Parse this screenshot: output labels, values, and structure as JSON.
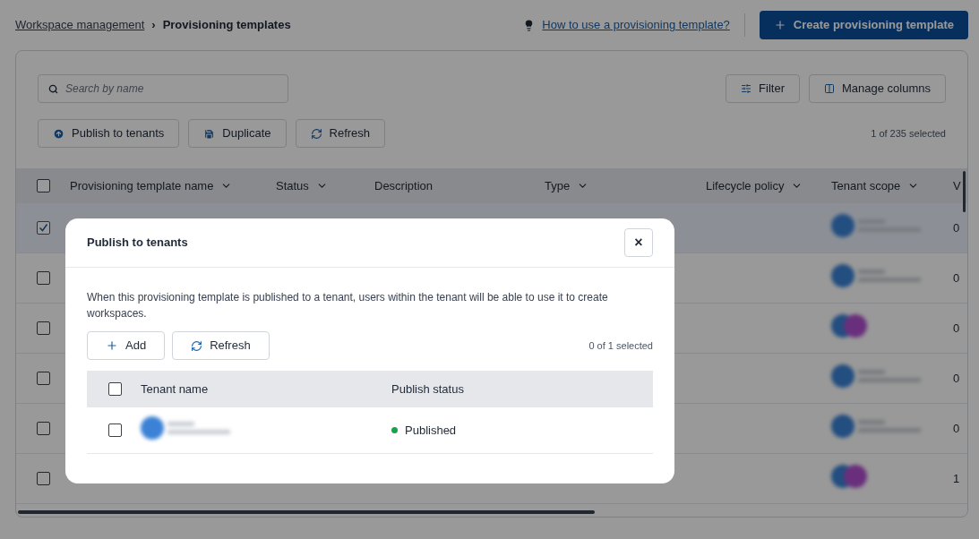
{
  "breadcrumb": {
    "parent": "Workspace management",
    "separator": "›",
    "current": "Provisioning templates"
  },
  "help_link": "How to use a provisioning template?",
  "create_button": "Create provisioning template",
  "search": {
    "placeholder": "Search by name"
  },
  "filter_button": "Filter",
  "manage_columns_button": "Manage columns",
  "actions": [
    {
      "kind": "publish",
      "label": "Publish to tenants"
    },
    {
      "kind": "duplicate",
      "label": "Duplicate"
    },
    {
      "kind": "refresh",
      "label": "Refresh"
    }
  ],
  "selection_count": "1 of 235 selected",
  "table": {
    "header_checked": false,
    "columns": [
      {
        "label": "Provisioning template name",
        "kind": "sortable"
      },
      {
        "label": "Status",
        "kind": "sortable"
      },
      {
        "label": "Description",
        "kind": "plain"
      },
      {
        "label": "Type",
        "kind": "sortable"
      },
      {
        "label": "Lifecycle policy",
        "kind": "sortable"
      },
      {
        "label": "Tenant scope",
        "kind": "sortable"
      },
      {
        "label": "V",
        "kind": "plain"
      }
    ],
    "rows": [
      {
        "selected": true,
        "kind": "single",
        "column_8": "0"
      },
      {
        "selected": false,
        "kind": "single",
        "column_8": "0"
      },
      {
        "selected": false,
        "kind": "multi",
        "column_8": "0"
      },
      {
        "selected": false,
        "kind": "single",
        "column_8": "0"
      },
      {
        "selected": false,
        "kind": "single",
        "column_8": "0"
      },
      {
        "selected": false,
        "kind": "multi",
        "column_8": "1"
      }
    ]
  },
  "dialog": {
    "title": "Publish to tenants",
    "close": "×",
    "description": "When this provisioning template is published to a tenant, users within the tenant will be able to use it to create workspaces.",
    "actions": [
      {
        "kind": "add",
        "label": "Add"
      },
      {
        "kind": "refresh",
        "label": "Refresh"
      }
    ],
    "selection_count": "0 of 1 selected",
    "header_checked": false,
    "columns": [
      "Tenant name",
      "Publish status"
    ],
    "rows": [
      {
        "selected": false,
        "status": "Published",
        "color": "#16a34a"
      }
    ]
  }
}
